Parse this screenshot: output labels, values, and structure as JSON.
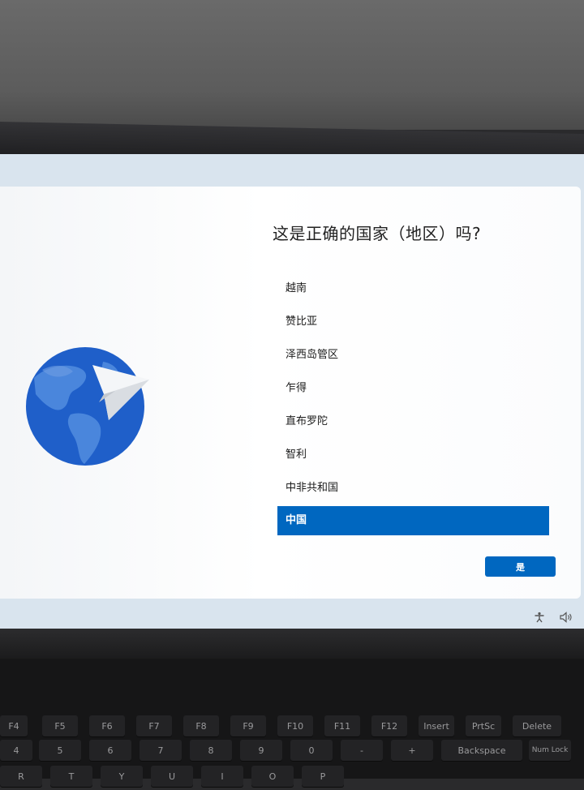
{
  "setup": {
    "question": "这是正确的国家（地区）吗?",
    "countries": [
      {
        "label": "越南"
      },
      {
        "label": "赞比亚"
      },
      {
        "label": "泽西岛管区"
      },
      {
        "label": "乍得"
      },
      {
        "label": "直布罗陀"
      },
      {
        "label": "智利"
      },
      {
        "label": "中非共和国"
      },
      {
        "label": "中国",
        "selected": true
      }
    ],
    "confirm_label": "是"
  },
  "tray": {
    "icons": [
      "accessibility-icon",
      "volume-icon"
    ]
  },
  "colors": {
    "accent": "#0067c0",
    "card_bg": "#ffffff",
    "globe_blue": "#1f5fc9"
  },
  "keyboard": {
    "fn_row": [
      "F4",
      "F5",
      "F6",
      "F7",
      "F8",
      "F9",
      "F10",
      "F11",
      "F12",
      "Insert",
      "PrtSc",
      "Delete"
    ],
    "number_row": [
      "4",
      "5",
      "6",
      "7",
      "8",
      "9",
      "0",
      "-",
      "+",
      "Backspace",
      "Num Lock"
    ],
    "letter_row": [
      "R",
      "T",
      "Y",
      "U",
      "I",
      "O",
      "P"
    ]
  }
}
